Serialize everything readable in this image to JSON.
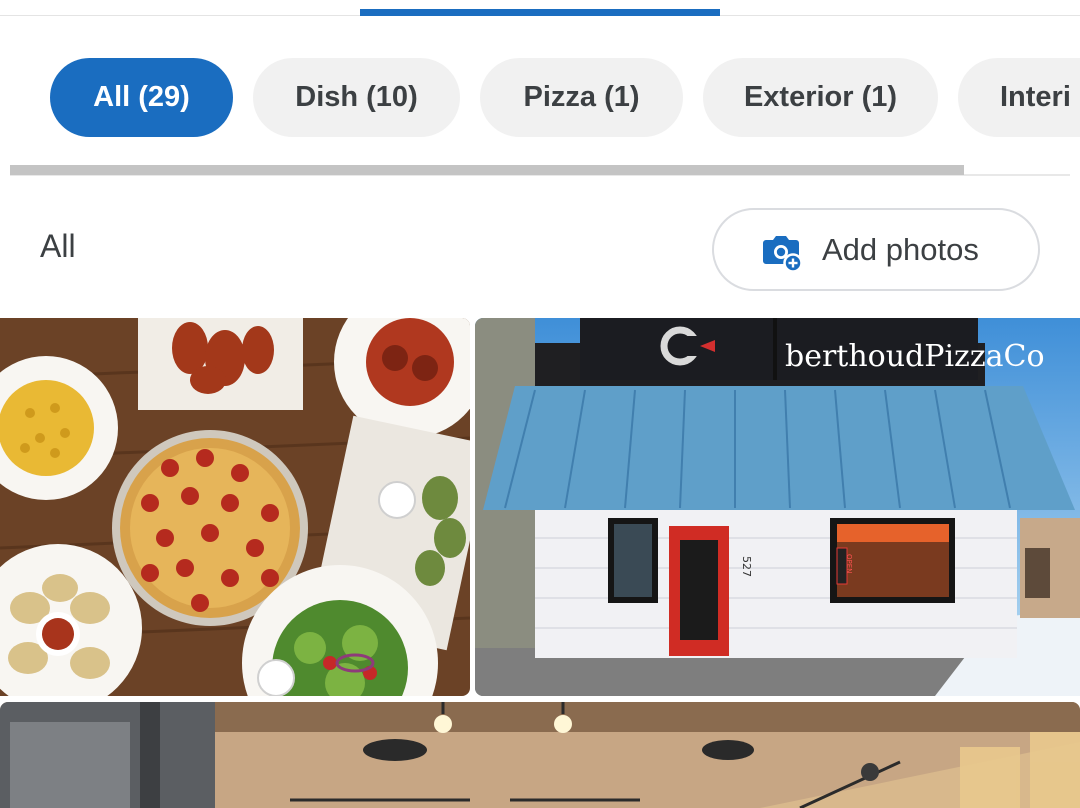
{
  "chips": [
    {
      "label": "All (29)",
      "selected": true
    },
    {
      "label": "Dish (10)",
      "selected": false
    },
    {
      "label": "Pizza (1)",
      "selected": false
    },
    {
      "label": "Exterior (1)",
      "selected": false
    },
    {
      "label": "Interi",
      "selected": false
    }
  ],
  "section": {
    "title": "All"
  },
  "add_photos": {
    "label": "Add photos"
  },
  "photos": {
    "storefront_sign": "berthoudPizzaCo",
    "storefront_number": "527",
    "storefront_open_sign": "OPEN"
  },
  "colors": {
    "accent": "#1a6dc0",
    "chip_bg": "#f1f1f1"
  }
}
